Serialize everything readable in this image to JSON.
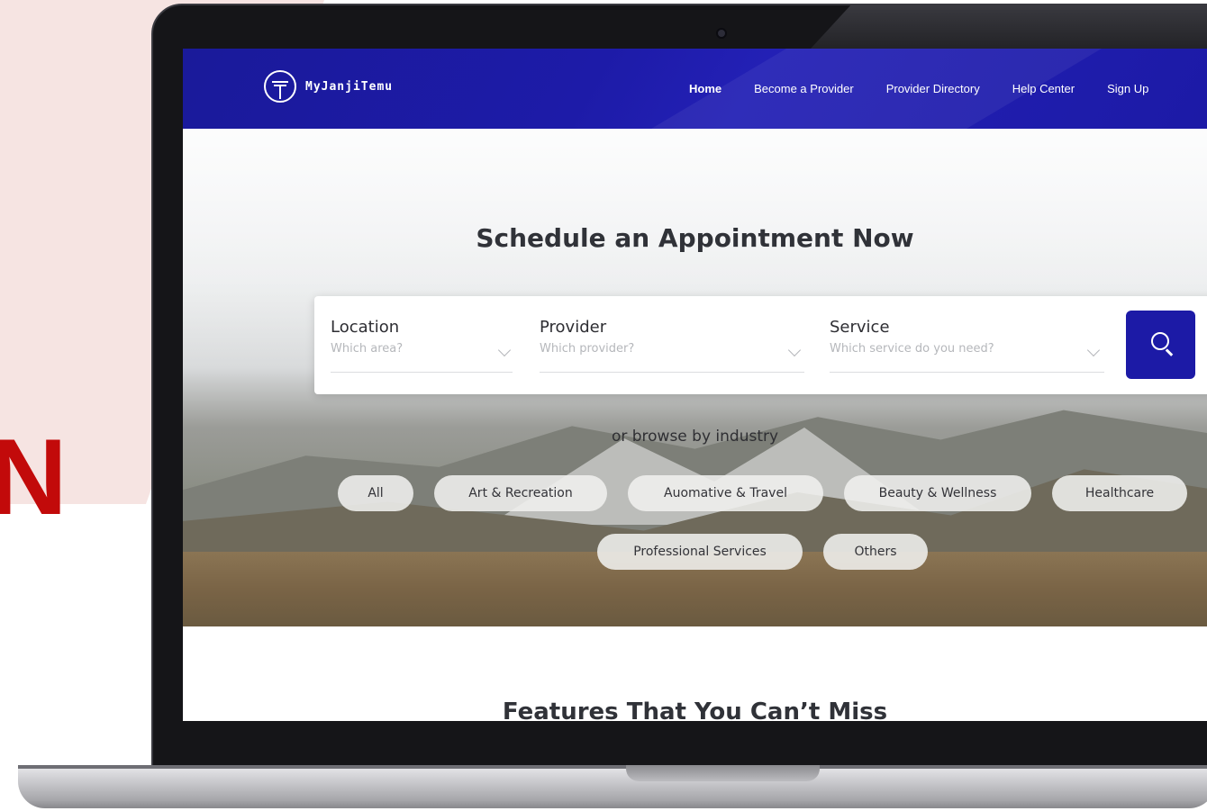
{
  "brand": {
    "letter": "N",
    "logo_name": "MyJanjiTemu"
  },
  "nav": {
    "links": [
      "Home",
      "Become a Provider",
      "Provider Directory",
      "Help Center",
      "Sign Up"
    ],
    "active": "Home"
  },
  "hero": {
    "title": "Schedule an Appointment Now",
    "search": {
      "location": {
        "label": "Location",
        "placeholder": "Which area?"
      },
      "provider": {
        "label": "Provider",
        "placeholder": "Which provider?"
      },
      "service": {
        "label": "Service",
        "placeholder": "Which service do you need?"
      }
    },
    "browse_label": "or browse by industry",
    "industries": [
      "All",
      "Art & Recreation",
      "Auomative & Travel",
      "Beauty & Wellness",
      "Healthcare",
      "Professional Services",
      "Others"
    ]
  },
  "features": {
    "title": "Features That You Can’t Miss"
  },
  "colors": {
    "nav_bg": "#1c1aa6",
    "accent_red": "#c20a0a",
    "search_button": "#1c1aa6"
  },
  "icons": {
    "search": "search-icon",
    "chevron": "chevron-down-icon",
    "logo": "logo-icon"
  }
}
